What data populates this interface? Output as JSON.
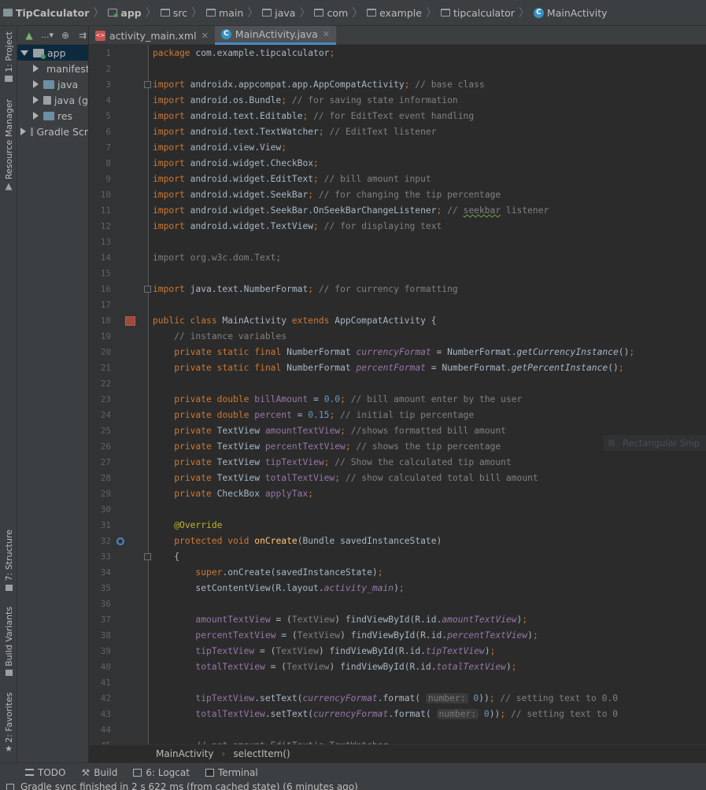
{
  "navbar": {
    "crumbs": [
      "TipCalculator",
      "app",
      "src",
      "main",
      "java",
      "com",
      "example",
      "tipcalculator",
      "MainActivity"
    ]
  },
  "left_strip": {
    "project_tab": "1: Project",
    "resource_tab": "Resource Manager",
    "structure_tab": "7: Structure",
    "build_variants_tab": "Build Variants",
    "favorites_tab": "2: Favorites"
  },
  "project_tree": {
    "toolbar_dropdown": "...",
    "items": [
      {
        "label": "app"
      },
      {
        "label": "manifests"
      },
      {
        "label": "java"
      },
      {
        "label": "java (g"
      },
      {
        "label": "res"
      },
      {
        "label": "Gradle Scr"
      }
    ]
  },
  "editor_tabs": [
    {
      "label": "activity_main.xml"
    },
    {
      "label": "MainActivity.java"
    }
  ],
  "code_lines": [
    "package com.example.tipcalculator;",
    "",
    "import androidx.appcompat.app.AppCompatActivity; // base class",
    "import android.os.Bundle; // for saving state information",
    "import android.text.Editable; // for EditText event handling",
    "import android.text.TextWatcher; // EditText listener",
    "import android.view.View;",
    "import android.widget.CheckBox;",
    "import android.widget.EditText; // bill amount input",
    "import android.widget.SeekBar; // for changing the tip percentage",
    "import android.widget.SeekBar.OnSeekBarChangeListener; // seekbar listener",
    "import android.widget.TextView; // for displaying text",
    "",
    "import org.w3c.dom.Text;",
    "",
    "import java.text.NumberFormat; // for currency formatting",
    "",
    "public class MainActivity extends AppCompatActivity {",
    "    // instance variables",
    "    private static final NumberFormat currencyFormat = NumberFormat.getCurrencyInstance();",
    "    private static final NumberFormat percentFormat = NumberFormat.getPercentInstance();",
    "",
    "    private double billAmount = 0.0; // bill amount enter by the user",
    "    private double percent = 0.15; // initial tip percentage",
    "    private TextView amountTextView; //shows formatted bill amount",
    "    private TextView percentTextView; // shows the tip percentage",
    "    private TextView tipTextView; // Show the calculated tip amount",
    "    private TextView totalTextView; // show calculated total bill amount",
    "    private CheckBox applyTax;",
    "",
    "    @Override",
    "    protected void onCreate(Bundle savedInstanceState)",
    "    {",
    "        super.onCreate(savedInstanceState);",
    "        setContentView(R.layout.activity_main);",
    "",
    "        amountTextView = (TextView) findViewById(R.id.amountTextView);",
    "        percentTextView = (TextView) findViewById(R.id.percentTextView);",
    "        tipTextView = (TextView) findViewById(R.id.tipTextView);",
    "        totalTextView = (TextView) findViewById(R.id.totalTextView);",
    "",
    "        tipTextView.setText(currencyFormat.format( number: 0)); // setting text to 0.0",
    "        totalTextView.setText(currencyFormat.format( number: 0)); // setting text to 0",
    "",
    "        // set amount EditText's TextWatcher"
  ],
  "snip_hint": "Rectangular Snip",
  "editor_breadcrumbs": [
    "MainActivity",
    "selectItem()"
  ],
  "bottom_bar": [
    {
      "label": "TODO",
      "icon": "list-icon"
    },
    {
      "label": "Build",
      "icon": "hammer-icon"
    },
    {
      "label": "6: Logcat",
      "icon": "logcat-icon"
    },
    {
      "label": "Terminal",
      "icon": "terminal-icon"
    }
  ],
  "status": "Gradle sync finished in 2 s 622 ms (from cached state) (6 minutes ago)",
  "colors": {
    "keyword": "#cc7832",
    "comment": "#808080",
    "number": "#6897bb",
    "field": "#9876aa",
    "method": "#ffc66d",
    "annotation": "#bbb529",
    "selection": "#0d293e",
    "accent": "#4a88c7"
  }
}
